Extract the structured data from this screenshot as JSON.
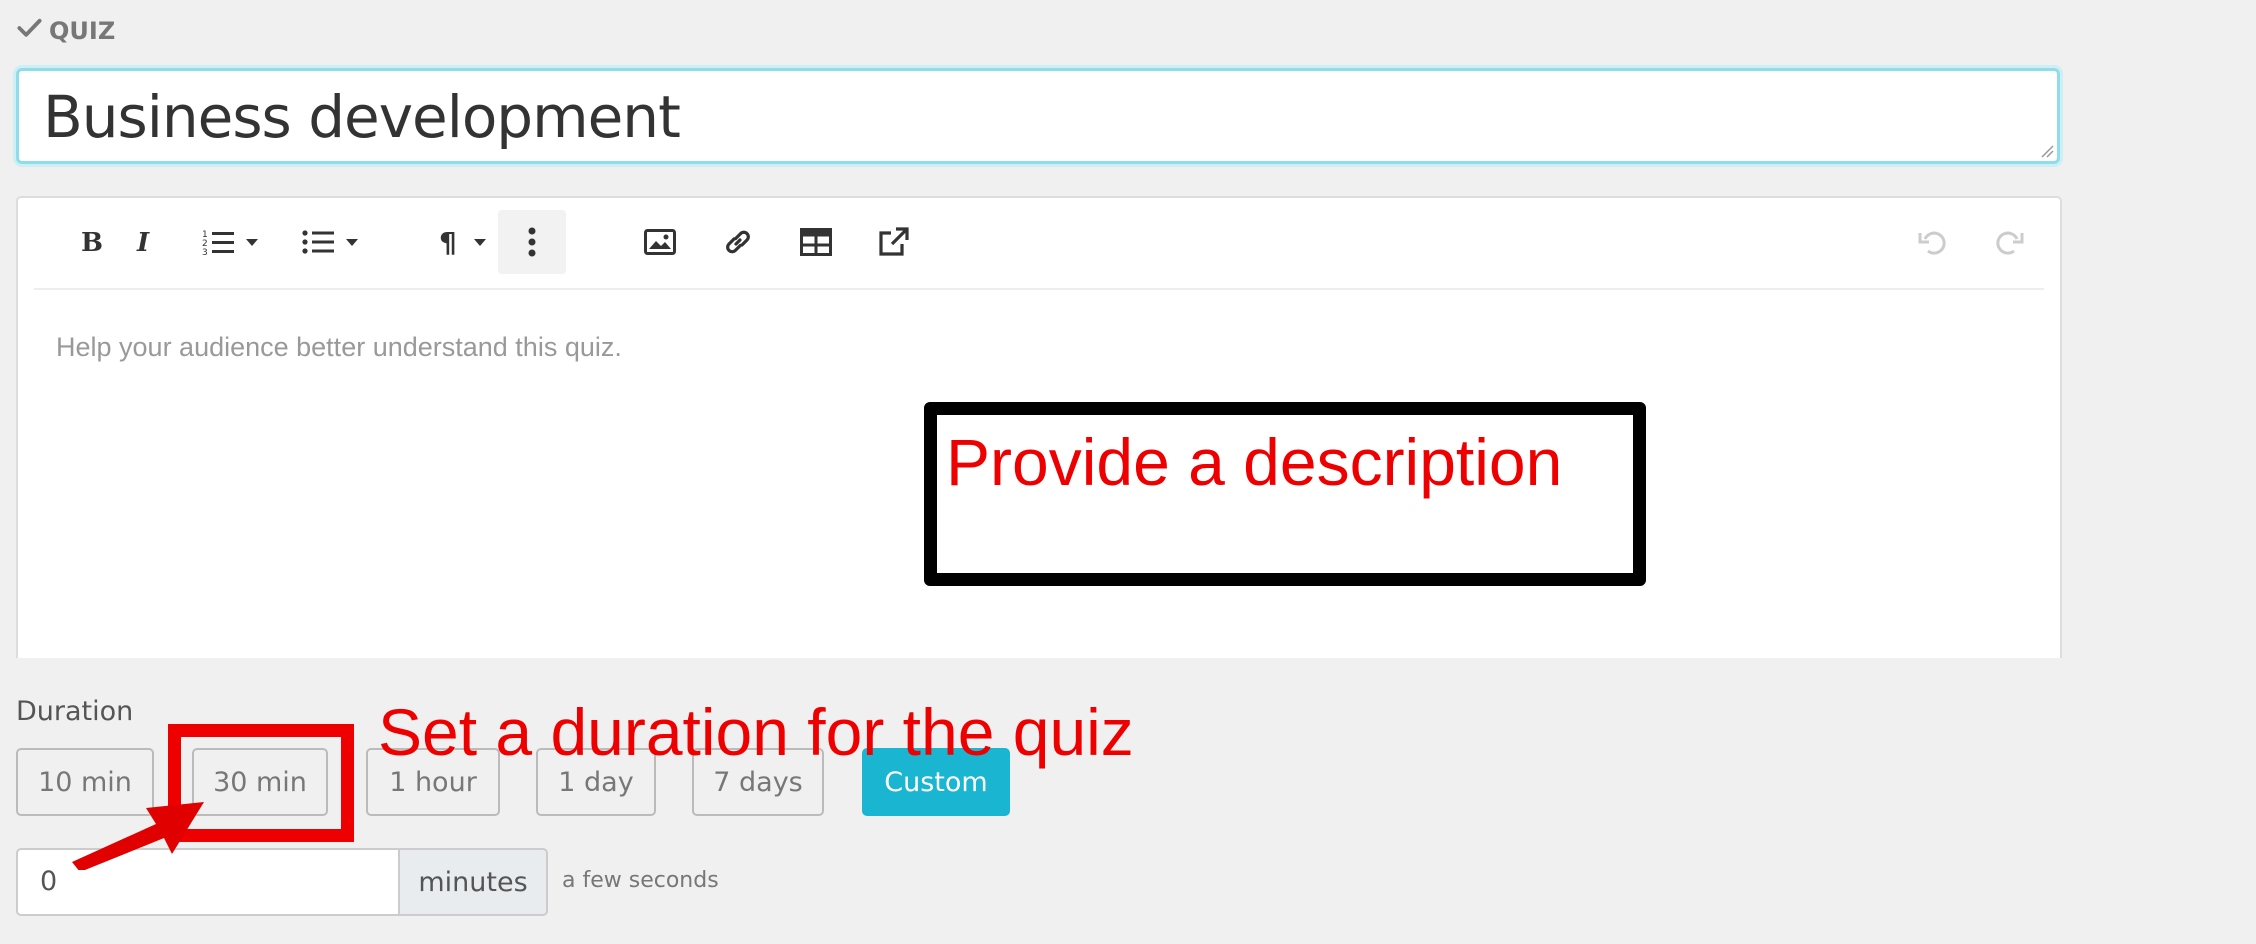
{
  "header": {
    "label": "QUIZ",
    "icon": "check-icon"
  },
  "title": {
    "value": "Business development"
  },
  "editor": {
    "toolbar": [
      {
        "name": "bold",
        "icon": "bold-icon"
      },
      {
        "name": "italic",
        "icon": "italic-icon"
      },
      {
        "name": "ordered-list",
        "icon": "ordered-list-icon"
      },
      {
        "name": "bulleted-list",
        "icon": "bulleted-list-icon"
      },
      {
        "name": "paragraph",
        "icon": "paragraph-icon"
      },
      {
        "name": "more",
        "icon": "more-vertical-icon"
      },
      {
        "name": "image",
        "icon": "image-icon"
      },
      {
        "name": "link",
        "icon": "link-icon"
      },
      {
        "name": "table",
        "icon": "table-icon"
      },
      {
        "name": "embed",
        "icon": "external-link-icon"
      },
      {
        "name": "undo",
        "icon": "undo-icon"
      },
      {
        "name": "redo",
        "icon": "redo-icon"
      }
    ],
    "placeholder": "Help your audience better understand this quiz."
  },
  "duration": {
    "label": "Duration",
    "options": [
      "10 min",
      "30 min",
      "1 hour",
      "1 day",
      "7 days",
      "Custom"
    ],
    "selected": "Custom",
    "input_value": "0",
    "unit": "minutes",
    "relative_time": "a few seconds"
  },
  "annotations": {
    "description_note": "Provide a description",
    "duration_note": "Set a duration for the quiz"
  },
  "colors": {
    "accent": "#1ab5d0",
    "annotation_red": "#e00000",
    "title_focus_border": "#8fdde9"
  }
}
